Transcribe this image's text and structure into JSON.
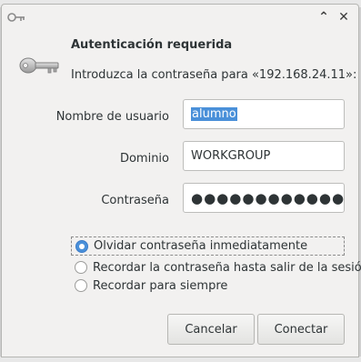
{
  "window": {
    "heading": "Autenticación requerida",
    "prompt": "Introduzca la contraseña para «192.168.24.11»:",
    "minimize_glyph": "⌃",
    "close_glyph": "✕"
  },
  "icons": {
    "title_icon": "key-icon",
    "dialog_icon": "key-icon"
  },
  "form": {
    "username_label": "Nombre de usuario",
    "username_value": "alumno",
    "domain_label": "Dominio",
    "domain_value": "WORKGROUP",
    "password_label": "Contraseña",
    "password_mask": "●●●●●●●●●●●●"
  },
  "options": [
    {
      "label": "Olvidar contraseña inmediatamente",
      "selected": true
    },
    {
      "label": "Recordar la contraseña hasta salir de la sesión",
      "selected": false
    },
    {
      "label": "Recordar para siempre",
      "selected": false
    }
  ],
  "buttons": {
    "cancel": "Cancelar",
    "connect": "Conectar"
  },
  "colors": {
    "accent": "#4a90d9",
    "dialog_bg": "#f2f1f0"
  }
}
